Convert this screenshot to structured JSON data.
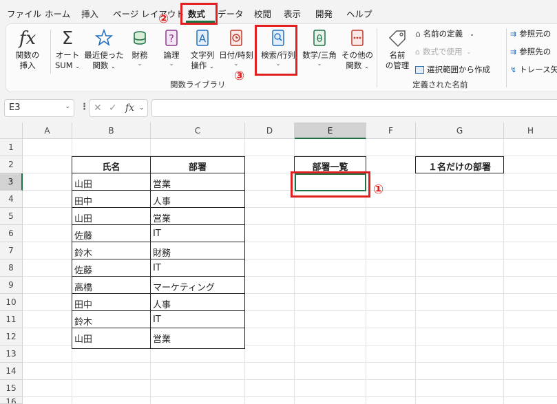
{
  "menu": {
    "tabs": [
      "ファイル",
      "ホーム",
      "挿入",
      "ページ レイアウト",
      "数式",
      "データ",
      "校閲",
      "表示",
      "開発",
      "ヘルプ"
    ]
  },
  "ribbon": {
    "insert_function": {
      "line1": "関数の",
      "line2": "挿入"
    },
    "autosum": {
      "line1": "オート",
      "line2": "SUM"
    },
    "recent": {
      "line1": "最近使った",
      "line2": "関数"
    },
    "financial": {
      "line1": "財務"
    },
    "logical": {
      "line1": "論理"
    },
    "text": {
      "line1": "文字列",
      "line2": "操作"
    },
    "datetime": {
      "line1": "日付/時刻"
    },
    "lookup": {
      "line1": "検索/行列"
    },
    "math": {
      "line1": "数学/三角"
    },
    "more": {
      "line1": "その他の",
      "line2": "関数"
    },
    "library_label": "関数ライブラリ",
    "name_manager": {
      "line1": "名前",
      "line2": "の管理"
    },
    "define_name": "名前の定義",
    "use_in_formula": "数式で使用",
    "create_from_selection": "選択範囲から作成",
    "defined_names_label": "定義された名前",
    "trace_precedents": "参照元の",
    "trace_dependents": "参照先の",
    "remove_arrows": "トレース矢"
  },
  "formula_bar": {
    "name_box": "E3",
    "formula": ""
  },
  "columns": [
    "A",
    "B",
    "C",
    "D",
    "E",
    "F",
    "G",
    "H"
  ],
  "rows": [
    "1",
    "2",
    "3",
    "4",
    "5",
    "6",
    "7",
    "8",
    "9",
    "10",
    "11",
    "12",
    "13",
    "14",
    "15",
    "16"
  ],
  "table": {
    "headers": [
      "氏名",
      "部署"
    ],
    "rows": [
      [
        "山田",
        "営業"
      ],
      [
        "田中",
        "人事"
      ],
      [
        "山田",
        "営業"
      ],
      [
        "佐藤",
        "IT"
      ],
      [
        "鈴木",
        "財務"
      ],
      [
        "佐藤",
        "IT"
      ],
      [
        "高橋",
        "マーケティング"
      ],
      [
        "田中",
        "人事"
      ],
      [
        "鈴木",
        "IT"
      ],
      [
        "山田",
        "営業"
      ]
    ]
  },
  "dept_list_header": "部署一覧",
  "single_dept_header": "１名だけの部署",
  "annotations": {
    "step1": "①",
    "step2": "②",
    "step3": "③"
  },
  "colors": {
    "accent": "#1e7145",
    "annotation": "#e02020"
  }
}
